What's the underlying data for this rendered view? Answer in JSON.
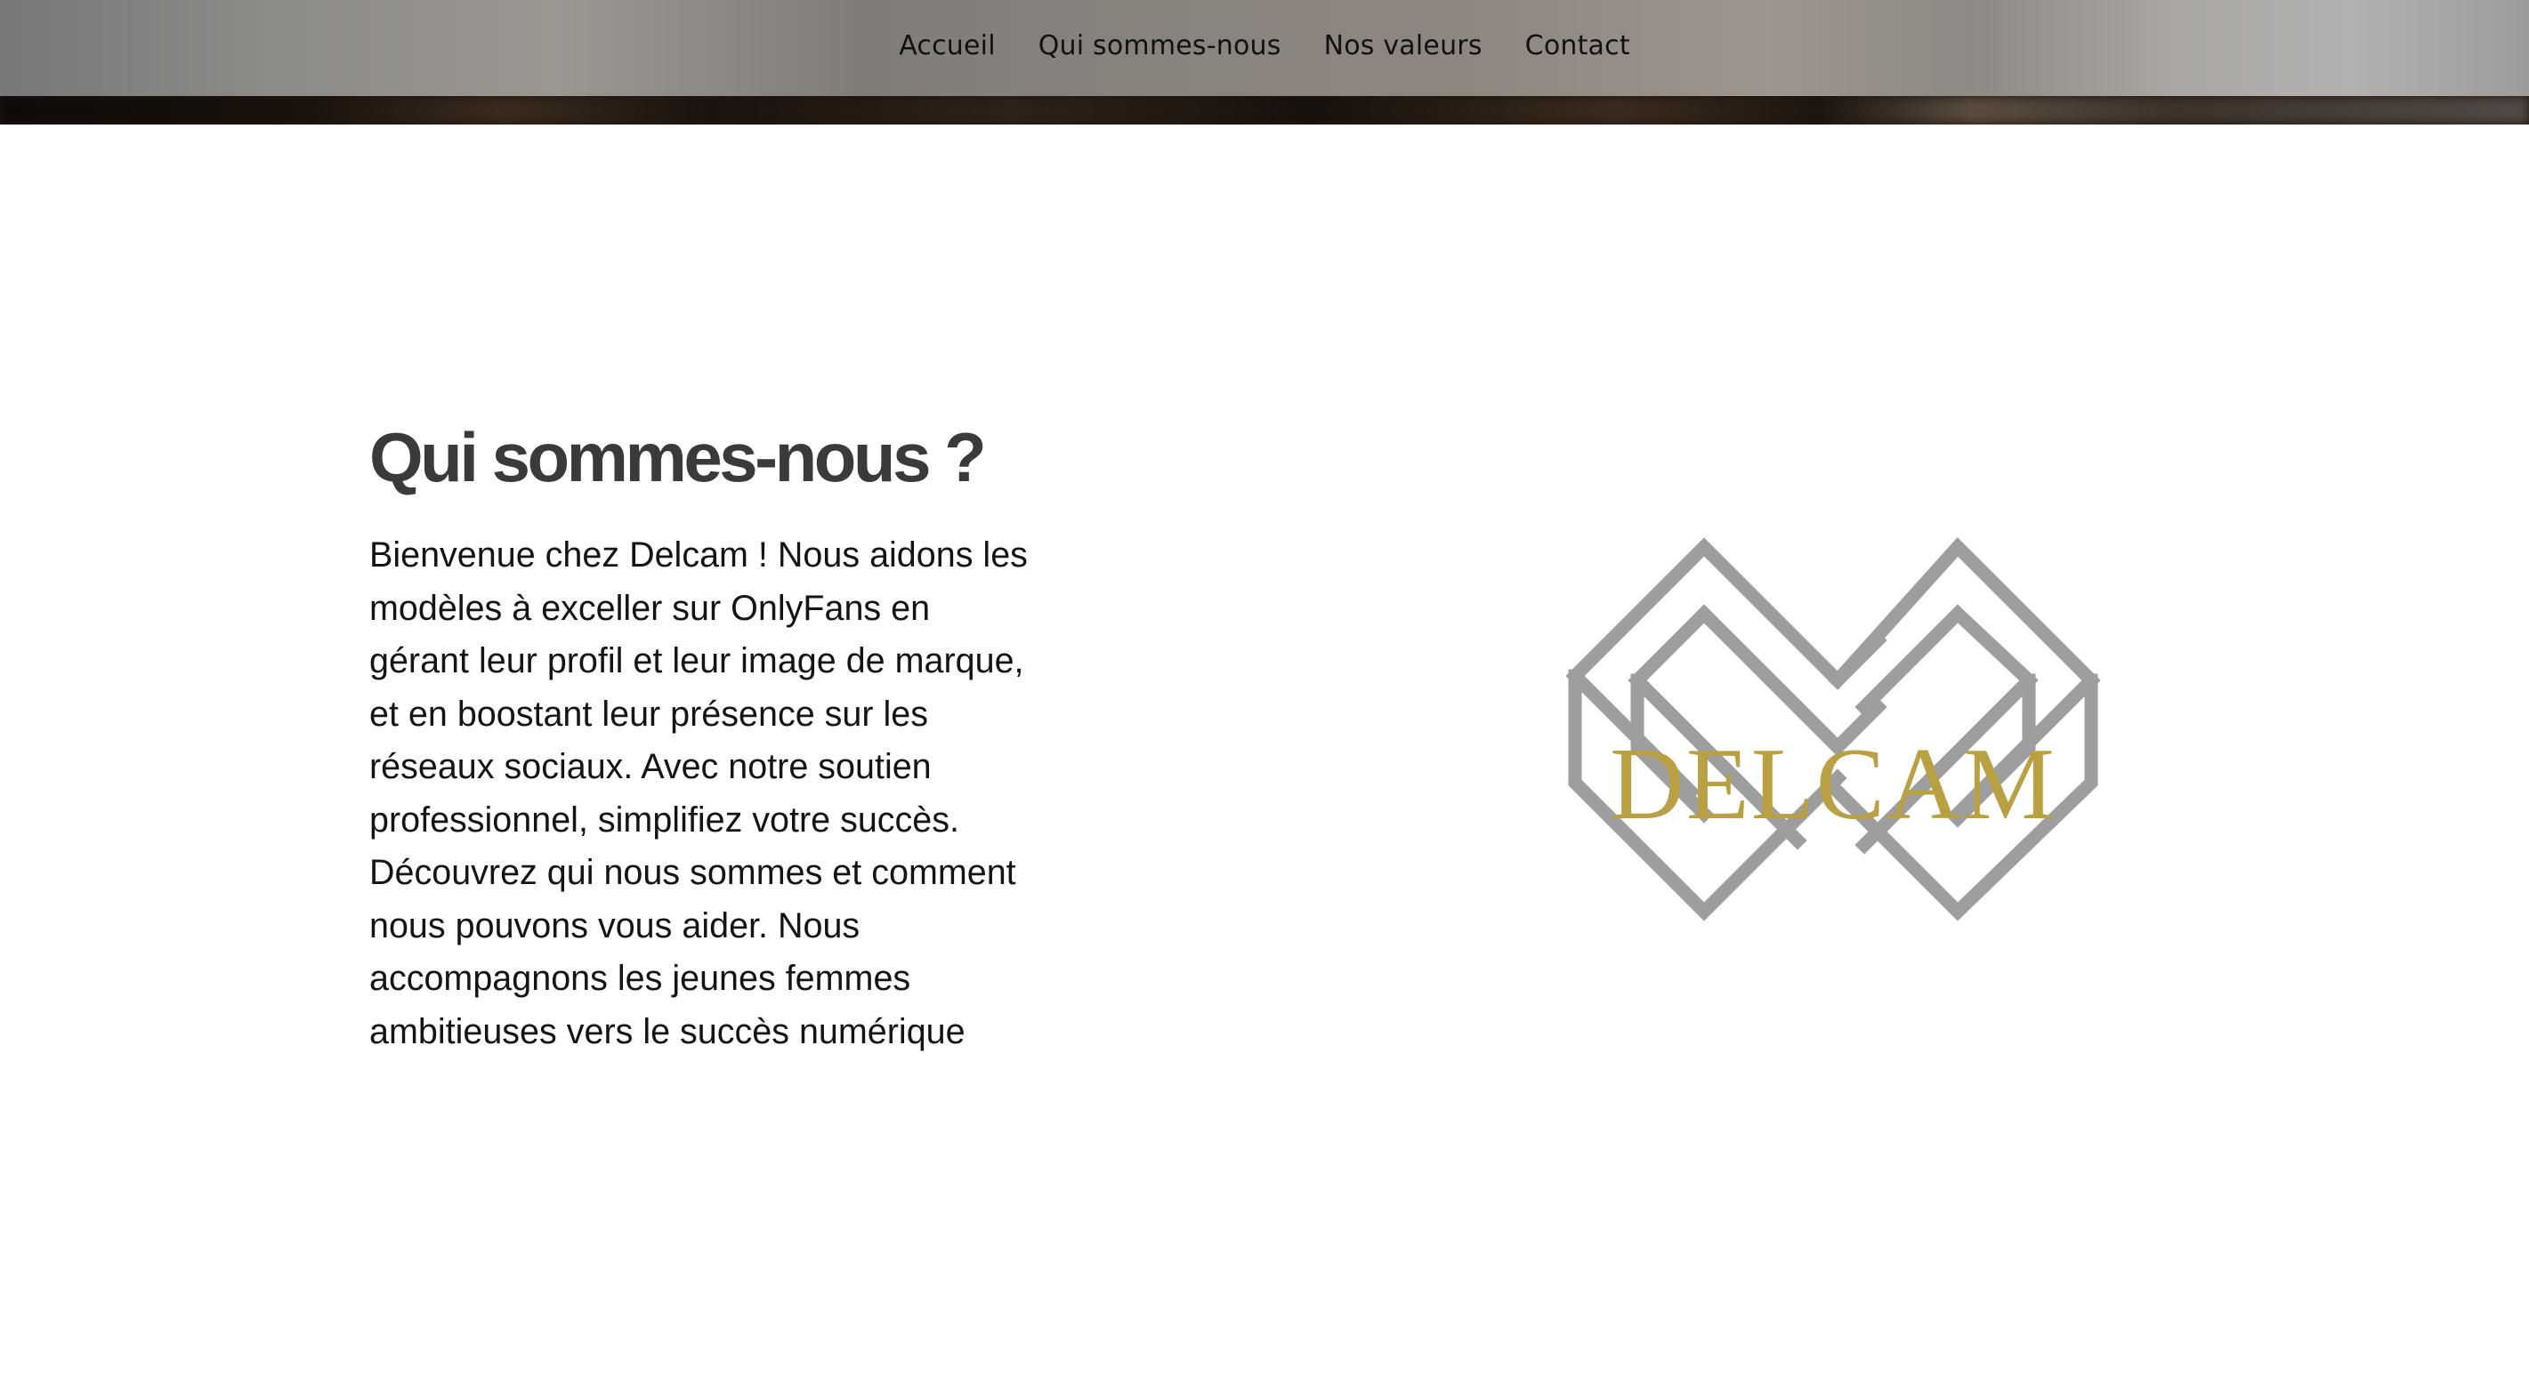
{
  "nav": {
    "items": [
      {
        "label": "Accueil"
      },
      {
        "label": "Qui sommes-nous"
      },
      {
        "label": "Nos valeurs"
      },
      {
        "label": "Contact"
      }
    ]
  },
  "about": {
    "title": "Qui sommes-nous ?",
    "paragraph": "Bienvenue chez Delcam ! Nous aidons les modèles à exceller sur OnlyFans en gérant leur profil et leur image de marque, et en boostant leur présence sur les réseaux sociaux. Avec notre soutien professionnel, simplifiez votre succès. Découvrez qui nous sommes et comment nous pouvons vous aider. Nous accompagnons les jeunes femmes ambitieuses vers le succès numérique"
  },
  "logo": {
    "text": "DELCAM",
    "colors": {
      "outline": "#9e9e9e",
      "text": "#b8a043"
    }
  },
  "colors": {
    "title": "#3a3a3a",
    "body_text": "#141414",
    "nav_text": "#111111",
    "background": "#ffffff"
  }
}
